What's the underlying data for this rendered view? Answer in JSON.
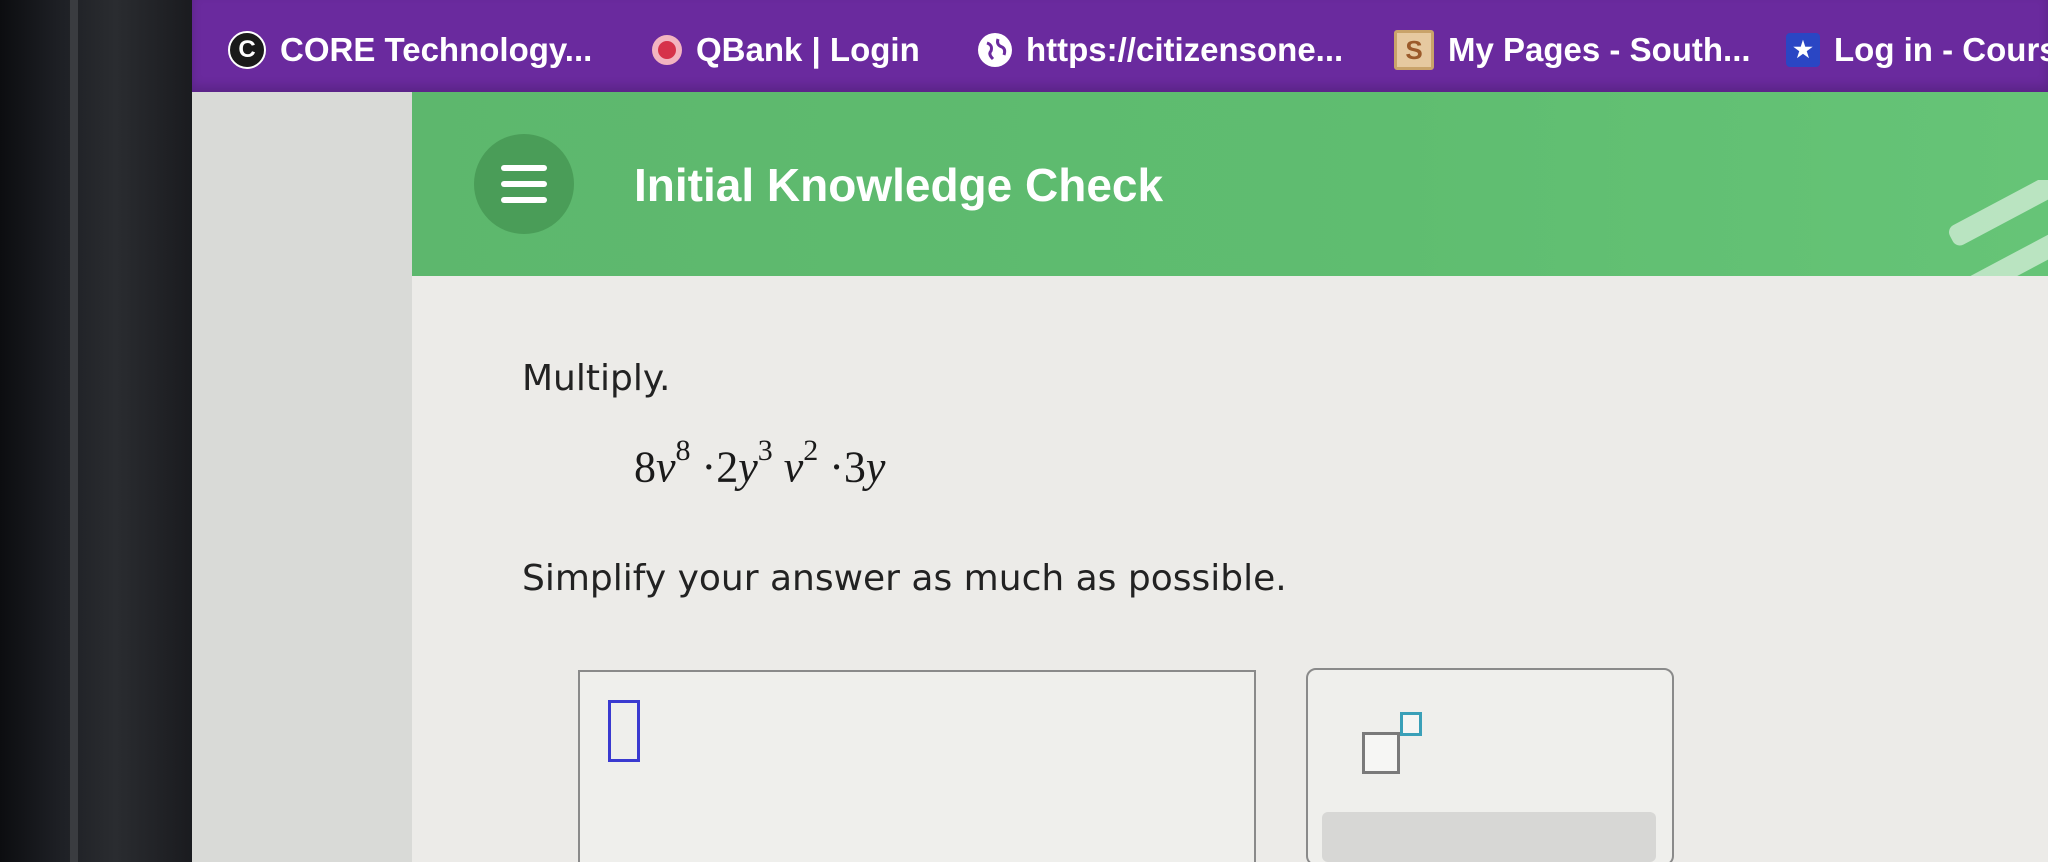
{
  "bookmarks": [
    {
      "label": "CORE Technology...",
      "icon": "core-logo-icon"
    },
    {
      "label": "QBank | Login",
      "icon": "qbank-dot-icon"
    },
    {
      "label": "https://citizensone...",
      "icon": "globe-icon"
    },
    {
      "label": "My Pages - South...",
      "icon": "s-logo-icon"
    },
    {
      "label": "Log in - Course",
      "icon": "star-icon"
    }
  ],
  "header": {
    "title": "Initial Knowledge Check",
    "color": "#5fbd70"
  },
  "question": {
    "instruction": "Multiply.",
    "expression": {
      "t1_coef": "8",
      "t1_var": "v",
      "t1_exp": "8",
      "dot1": "·",
      "t2_coef": "2",
      "t2_var": "y",
      "t2_exp": "3",
      "t3_var": "v",
      "t3_exp": "2",
      "dot2": "·",
      "t4_coef": "3",
      "t4_var": "y"
    },
    "note": "Simplify your answer as much as possible."
  },
  "colors": {
    "bookmark_bar": "#6a2a9e",
    "header_green": "#5fbd70",
    "cursor_blue": "#3a3ad0"
  }
}
